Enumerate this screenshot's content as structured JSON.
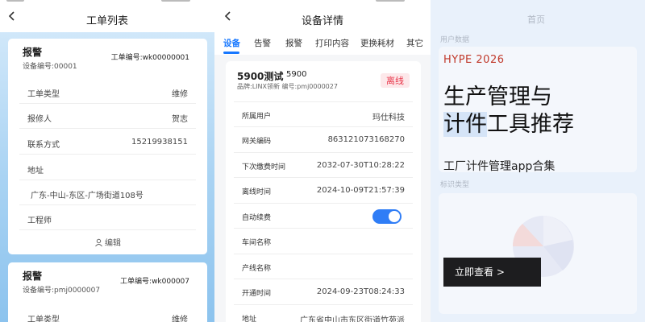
{
  "order_list": {
    "title": "工单列表",
    "cards": [
      {
        "title": "报警",
        "device_no": "设备编号:00001",
        "order_no": "工单编号:wk00000001",
        "fields": [
          {
            "label": "工单类型",
            "value": "维修"
          },
          {
            "label": "报修人",
            "value": "贺志"
          },
          {
            "label": "联系方式",
            "value": "15219938151"
          },
          {
            "label": "地址",
            "value": ""
          }
        ],
        "address": "广东-中山-东区-广场街道108号",
        "engineer_label": "工程师",
        "edit_label": "编辑"
      },
      {
        "title": "报警",
        "device_no": "设备编号:pmj0000007",
        "order_no": "工单编号:wk000007",
        "fields": [
          {
            "label": "工单类型",
            "value": "维修"
          }
        ]
      }
    ]
  },
  "device_detail": {
    "title": "设备详情",
    "tabs": [
      "设备",
      "告警",
      "报警",
      "打印内容",
      "更换耗材",
      "其它"
    ],
    "active_tab": 0,
    "device": {
      "name": "5900测试",
      "code": "5900",
      "sub": "品牌:LINX领新   编号:pmj0000027",
      "status": "离线"
    },
    "rows": [
      {
        "label": "所属用户",
        "value": "玛仕科技"
      },
      {
        "label": "网关编码",
        "value": "863121073168270"
      },
      {
        "label": "下次缴费时间",
        "value": "2032-07-30T10:28:22"
      },
      {
        "label": "离线时间",
        "value": "2024-10-09T21:57:39"
      },
      {
        "label": "自动续费",
        "value": ""
      },
      {
        "label": "车间名称",
        "value": ""
      },
      {
        "label": "产线名称",
        "value": ""
      },
      {
        "label": "开通时间",
        "value": "2024-09-23T08:24:33"
      },
      {
        "label": "地址",
        "value": "广东省中山市东区街道竹苑派"
      }
    ],
    "auto_renew": true
  },
  "home": {
    "title": "首页",
    "ghost_section1": "用户数据",
    "ghost_section2": "标识类型",
    "ad": {
      "brand": "HYPE 2026",
      "headline_line1": "生产管理与",
      "headline_line2_a": "计件",
      "headline_line2_b": "工具推荐",
      "subtitle": "工厂计件管理app合集",
      "cta": "立即查看 >"
    }
  },
  "colors": {
    "primary": "#1677ff",
    "offline_badge_bg": "#fde8ea",
    "offline_badge_text": "#e8364a",
    "ad_brand": "#c0392b",
    "cta_bg": "#1d1d1f"
  }
}
